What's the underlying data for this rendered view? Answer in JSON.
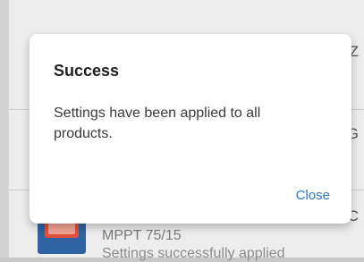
{
  "background": {
    "row_edge_letters": [
      "Z",
      "G",
      "C"
    ],
    "device": {
      "name": "MPPT 75/15",
      "status": "Settings successfully applied"
    }
  },
  "dialog": {
    "title": "Success",
    "message": "Settings have been applied to all products.",
    "close_label": "Close"
  },
  "colors": {
    "accent": "#2b76c7",
    "dim_background": "#d3d3d3",
    "dialog_background": "#ffffff"
  }
}
